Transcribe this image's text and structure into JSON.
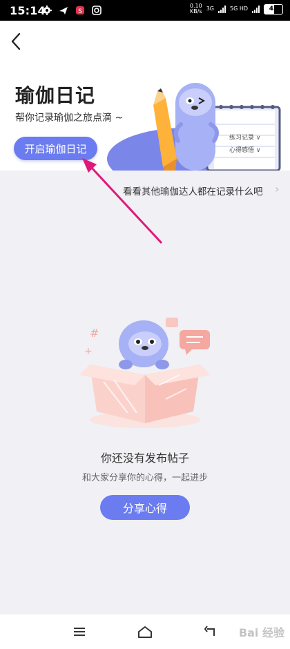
{
  "status_bar": {
    "time": "15:14",
    "speed_value": "0.10",
    "speed_unit": "KB/s",
    "net1": "3G",
    "net2": "5G HD",
    "battery": "45"
  },
  "header": {
    "title": "瑜伽日记",
    "subtitle": "帮你记录瑜伽之旅点滴 ~",
    "start_button": "开启瑜伽日记",
    "notebook_lines": [
      "练习记录 ∨",
      "心得感悟 ∨"
    ]
  },
  "discover": {
    "text": "看看其他瑜伽达人都在记录什么吧",
    "arrow": "›"
  },
  "empty_state": {
    "title": "你还没有发布帖子",
    "subtitle": "和大家分享你的心得，一起进步",
    "button": "分享心得"
  },
  "navbar": {
    "items": [
      "menu-icon",
      "home-icon",
      "back-icon"
    ]
  },
  "watermark": "Bai 经验",
  "colors": {
    "accent": "#6b7cf0",
    "annotation_arrow": "#e0187a"
  }
}
